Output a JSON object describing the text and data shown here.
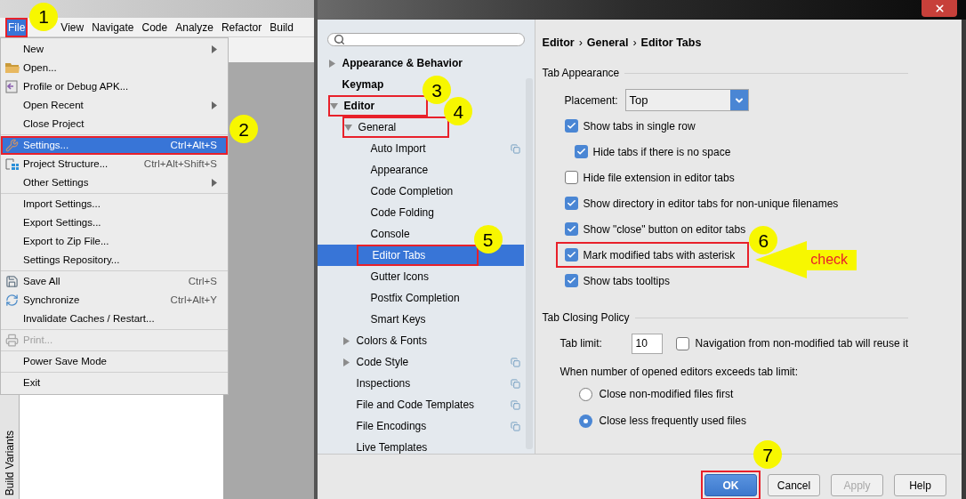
{
  "ide": {
    "menu_bar": [
      {
        "label": "File",
        "selected": true,
        "highlighted": true,
        "badge": "1"
      },
      {
        "label": "View",
        "selected": false,
        "highlighted": false
      },
      {
        "label": "Navigate",
        "selected": false,
        "highlighted": false
      },
      {
        "label": "Code",
        "selected": false,
        "highlighted": false
      },
      {
        "label": "Analyze",
        "selected": false,
        "highlighted": false
      },
      {
        "label": "Refactor",
        "selected": false,
        "highlighted": false
      },
      {
        "label": "Build",
        "selected": false,
        "highlighted": false
      }
    ],
    "file_menu": [
      [
        {
          "label": "New",
          "submenu": true,
          "selected": false,
          "disabled": false,
          "highlighted": false
        },
        {
          "label": "Open...",
          "submenu": false,
          "selected": false,
          "disabled": false,
          "highlighted": false
        },
        {
          "label": "Profile or Debug APK...",
          "submenu": false,
          "selected": false,
          "disabled": false,
          "highlighted": false
        },
        {
          "label": "Open Recent",
          "submenu": true,
          "selected": false,
          "disabled": false,
          "highlighted": false
        },
        {
          "label": "Close Project",
          "submenu": false,
          "selected": false,
          "disabled": false,
          "highlighted": false
        }
      ],
      [
        {
          "label": "Settings...",
          "shortcut": "Ctrl+Alt+S",
          "submenu": false,
          "selected": true,
          "disabled": false,
          "highlighted": true,
          "badge": "2"
        },
        {
          "label": "Project Structure...",
          "shortcut": "Ctrl+Alt+Shift+S",
          "submenu": false,
          "selected": false,
          "disabled": false,
          "highlighted": false
        },
        {
          "label": "Other Settings",
          "submenu": true,
          "selected": false,
          "disabled": false,
          "highlighted": false
        }
      ],
      [
        {
          "label": "Import Settings...",
          "submenu": false,
          "selected": false,
          "disabled": false,
          "highlighted": false
        },
        {
          "label": "Export Settings...",
          "submenu": false,
          "selected": false,
          "disabled": false,
          "highlighted": false
        },
        {
          "label": "Export to Zip File...",
          "submenu": false,
          "selected": false,
          "disabled": false,
          "highlighted": false
        },
        {
          "label": "Settings Repository...",
          "submenu": false,
          "selected": false,
          "disabled": false,
          "highlighted": false
        }
      ],
      [
        {
          "label": "Save All",
          "shortcut": "Ctrl+S",
          "submenu": false,
          "selected": false,
          "disabled": false,
          "highlighted": false
        },
        {
          "label": "Synchronize",
          "shortcut": "Ctrl+Alt+Y",
          "submenu": false,
          "selected": false,
          "disabled": false,
          "highlighted": false
        },
        {
          "label": "Invalidate Caches / Restart...",
          "submenu": false,
          "selected": false,
          "disabled": false,
          "highlighted": false
        }
      ],
      [
        {
          "label": "Print...",
          "submenu": false,
          "selected": false,
          "disabled": true,
          "highlighted": false
        }
      ],
      [
        {
          "label": "Power Save Mode",
          "submenu": false,
          "selected": false,
          "disabled": false,
          "highlighted": false
        }
      ],
      [
        {
          "label": "Exit",
          "submenu": false,
          "selected": false,
          "disabled": false,
          "highlighted": false
        }
      ]
    ],
    "side_tab": "Build Variants"
  },
  "dialog": {
    "tree": [
      {
        "label": "Appearance & Behavior",
        "bold": true,
        "expanded": false,
        "selected": false,
        "shared": false,
        "highlighted": false
      },
      {
        "label": "Keymap",
        "bold": true,
        "selected": false,
        "shared": false,
        "highlighted": false
      },
      {
        "label": "Editor",
        "bold": true,
        "expanded": true,
        "selected": false,
        "shared": false,
        "highlighted": true,
        "badge": "3",
        "children": [
          {
            "label": "General",
            "bold": false,
            "expanded": true,
            "selected": false,
            "shared": false,
            "highlighted": true,
            "badge": "4",
            "children": [
              {
                "label": "Auto Import",
                "bold": false,
                "selected": false,
                "shared": true,
                "highlighted": false
              },
              {
                "label": "Appearance",
                "bold": false,
                "selected": false,
                "shared": false,
                "highlighted": false
              },
              {
                "label": "Code Completion",
                "bold": false,
                "selected": false,
                "shared": false,
                "highlighted": false
              },
              {
                "label": "Code Folding",
                "bold": false,
                "selected": false,
                "shared": false,
                "highlighted": false
              },
              {
                "label": "Console",
                "bold": false,
                "selected": false,
                "shared": false,
                "highlighted": false
              },
              {
                "label": "Editor Tabs",
                "bold": false,
                "selected": true,
                "shared": false,
                "highlighted": true,
                "badge": "5"
              },
              {
                "label": "Gutter Icons",
                "bold": false,
                "selected": false,
                "shared": false,
                "highlighted": false
              },
              {
                "label": "Postfix Completion",
                "bold": false,
                "selected": false,
                "shared": false,
                "highlighted": false
              },
              {
                "label": "Smart Keys",
                "bold": false,
                "selected": false,
                "shared": false,
                "highlighted": false
              }
            ]
          },
          {
            "label": "Colors & Fonts",
            "bold": false,
            "expanded": false,
            "selected": false,
            "shared": false,
            "highlighted": false
          },
          {
            "label": "Code Style",
            "bold": false,
            "expanded": false,
            "selected": false,
            "shared": true,
            "highlighted": false
          },
          {
            "label": "Inspections",
            "bold": false,
            "selected": false,
            "shared": true,
            "highlighted": false
          },
          {
            "label": "File and Code Templates",
            "bold": false,
            "selected": false,
            "shared": true,
            "highlighted": false
          },
          {
            "label": "File Encodings",
            "bold": false,
            "selected": false,
            "shared": true,
            "highlighted": false
          },
          {
            "label": "Live Templates",
            "bold": false,
            "selected": false,
            "shared": false,
            "highlighted": false
          }
        ]
      }
    ],
    "breadcrumb": {
      "separator": "›",
      "parts": [
        "Editor",
        "General",
        "Editor Tabs"
      ]
    },
    "sections": [
      {
        "title": "Tab Appearance",
        "rows": [
          {
            "kind": "select",
            "label": "Placement:",
            "value": "Top"
          },
          {
            "kind": "checkbox",
            "label": "Show tabs in single row",
            "checked": true,
            "highlighted": false,
            "children": [
              {
                "kind": "checkbox",
                "label": "Hide tabs if there is no space",
                "checked": true,
                "highlighted": false
              }
            ]
          },
          {
            "kind": "checkbox",
            "label": "Hide file extension in editor tabs",
            "checked": false,
            "highlighted": false
          },
          {
            "kind": "checkbox",
            "label": "Show directory in editor tabs for non-unique filenames",
            "checked": true,
            "highlighted": false
          },
          {
            "kind": "checkbox",
            "label": "Show \"close\" button on editor tabs",
            "checked": true,
            "highlighted": false
          },
          {
            "kind": "checkbox",
            "label": "Mark modified tabs with asterisk",
            "checked": true,
            "highlighted": true,
            "badge": "6",
            "callout": "check"
          },
          {
            "kind": "checkbox",
            "label": "Show tabs tooltips",
            "checked": true,
            "highlighted": false
          }
        ]
      },
      {
        "title": "Tab Closing Policy",
        "rows": [
          {
            "kind": "limit",
            "label": "Tab limit:",
            "value": "10",
            "option": {
              "label": "Navigation from non-modified tab will reuse it",
              "checked": false
            }
          },
          {
            "kind": "text",
            "label": "When number of opened editors exceeds tab limit:"
          },
          {
            "kind": "radio",
            "label": "Close non-modified files first",
            "selected": false
          },
          {
            "kind": "radio",
            "label": "Close less frequently used files",
            "selected": true
          }
        ]
      }
    ],
    "buttons": [
      {
        "label": "OK",
        "kind": "primary",
        "disabled": false,
        "highlighted": true,
        "badge": "7"
      },
      {
        "label": "Cancel",
        "kind": "normal",
        "disabled": false,
        "highlighted": false
      },
      {
        "label": "Apply",
        "kind": "normal",
        "disabled": true,
        "highlighted": false
      },
      {
        "label": "Help",
        "kind": "normal",
        "disabled": false,
        "highlighted": false
      }
    ]
  }
}
